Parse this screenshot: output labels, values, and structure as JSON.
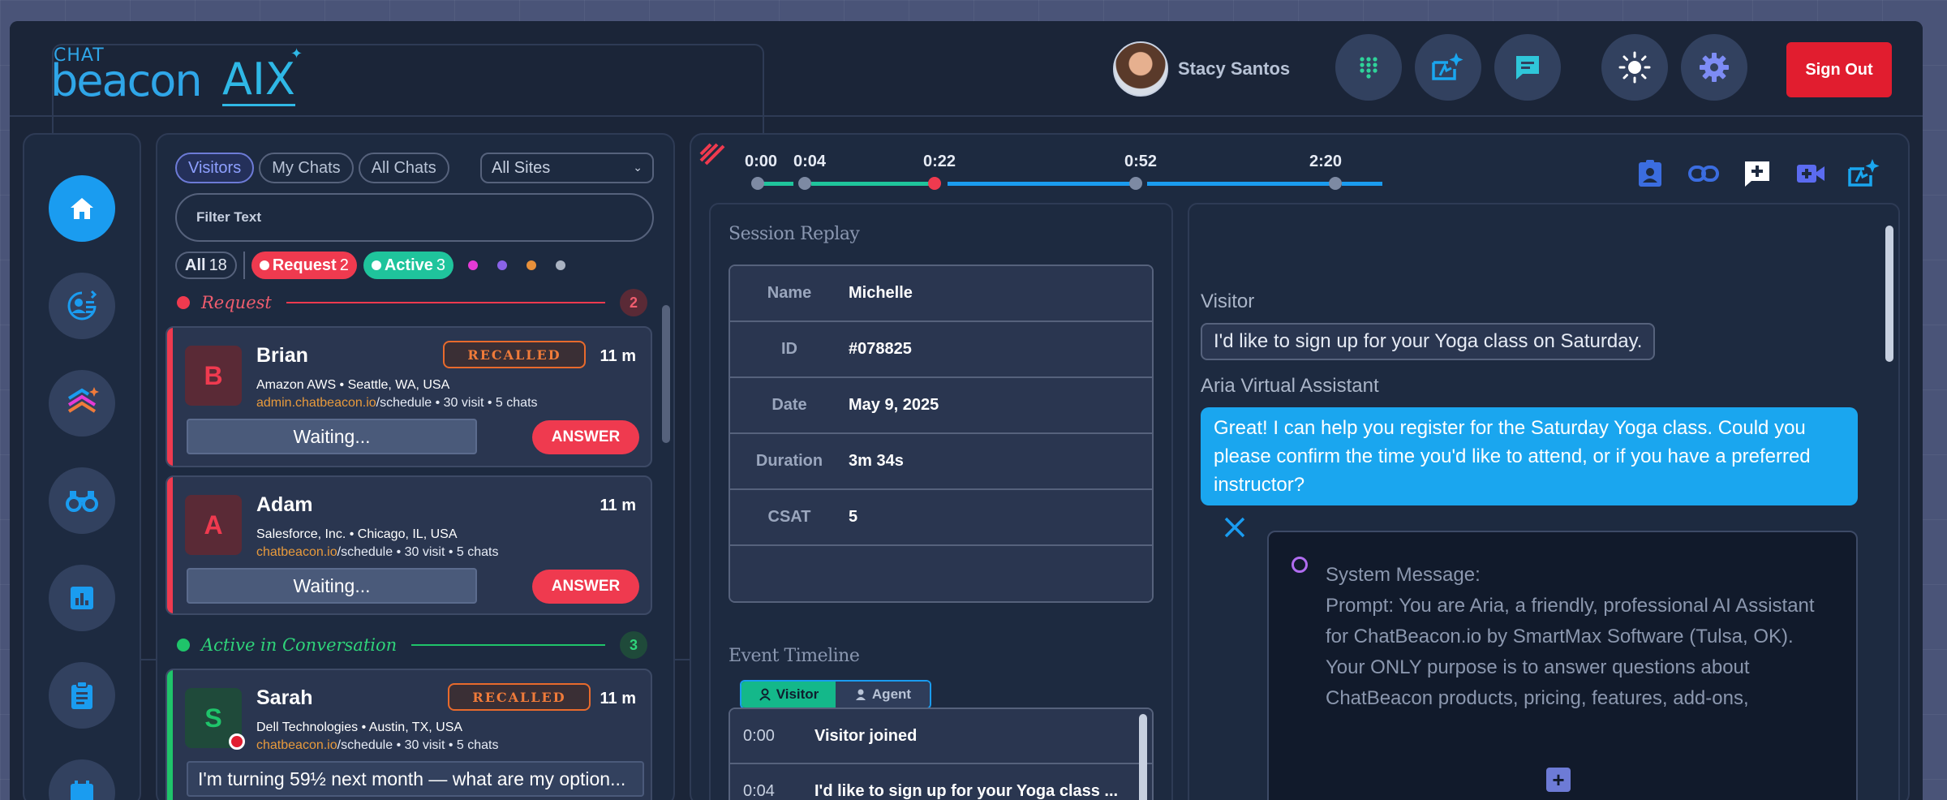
{
  "header": {
    "logo_chat": "CHAT",
    "logo_beacon": "beacon",
    "logo_aix": "AIX",
    "user_name": "Stacy Santos",
    "sign_out": "Sign Out"
  },
  "icons": {
    "header": [
      "grid-dots-icon",
      "ai-spark-icon",
      "chat-bubble-icon",
      "sun-icon",
      "gear-icon"
    ],
    "sidebar": [
      "home-icon",
      "agents-icon",
      "layers-icon",
      "binoculars-icon",
      "reports-icon",
      "clipboard-icon",
      "calendar-icon"
    ],
    "toolbar": [
      "contact-card-icon",
      "link-icon",
      "add-note-icon",
      "video-icon",
      "ai-spark-icon"
    ]
  },
  "list": {
    "tabs": [
      "Visitors",
      "My Chats",
      "All Chats"
    ],
    "site_select": "All Sites",
    "filter_placeholder": "Filter Text",
    "chips": {
      "all_label": "All",
      "all_count": "18",
      "request_label": "Request",
      "request_count": "2",
      "active_label": "Active",
      "active_count": "3"
    },
    "colors": [
      "#e63ad6",
      "#8a63e8",
      "#e8903a",
      "#aab3c2"
    ],
    "request_section": {
      "title": "Request",
      "count": "2"
    },
    "active_section": {
      "title": "Active in Conversation",
      "count": "3"
    },
    "cards": [
      {
        "initial": "B",
        "name": "Brian",
        "recalled": "RECALLED",
        "time": "11 m",
        "org": "Amazon AWS • Seattle, WA, USA",
        "domain": "admin.chatbeacon.io",
        "path": "/schedule • 30 visit • 5 chats",
        "status": "Waiting...",
        "action": "ANSWER"
      },
      {
        "initial": "A",
        "name": "Adam",
        "time": "11 m",
        "org": "Salesforce, Inc. • Chicago, IL, USA",
        "domain": "chatbeacon.io",
        "path": "/schedule • 30 visit • 5 chats",
        "status": "Waiting...",
        "action": "ANSWER"
      },
      {
        "initial": "S",
        "name": "Sarah",
        "recalled": "RECALLED",
        "time": "11 m",
        "org": "Dell Technologies • Austin, TX, USA",
        "domain": "chatbeacon.io",
        "path": "/schedule • 30 visit • 5 chats",
        "preview": "I'm turning 59½ next month — what are my option..."
      }
    ]
  },
  "timeline": {
    "marks": [
      "0:00",
      "0:04",
      "0:22",
      "0:52",
      "2:20"
    ]
  },
  "replay": {
    "title": "Session Replay",
    "rows": [
      {
        "label": "Name",
        "value": "Michelle"
      },
      {
        "label": "ID",
        "value": "#078825"
      },
      {
        "label": "Date",
        "value": "May 9, 2025"
      },
      {
        "label": "Duration",
        "value": "3m 34s"
      },
      {
        "label": "CSAT",
        "value": "5"
      }
    ],
    "event_title": "Event Timeline",
    "toggle_visitor": "Visitor",
    "toggle_agent": "Agent",
    "events": [
      {
        "time": "0:00",
        "text": "Visitor joined"
      },
      {
        "time": "0:04",
        "text": "I'd like to sign up for your Yoga class ..."
      }
    ]
  },
  "conversation": {
    "visitor_label": "Visitor",
    "visitor_msg": "I'd like to sign up for your Yoga class on Saturday.",
    "assistant_label": "Aria Virtual Assistant",
    "assistant_msg": "Great! I can help you register for the Saturday Yoga class. Could you please confirm the time you'd like to attend, or if you have a preferred instructor?",
    "system_title": "System Message:",
    "system_text": "Prompt: You are Aria, a friendly, professional AI Assistant for ChatBeacon.io by SmartMax Software (Tulsa, OK).",
    "system_text2": "Your ONLY purpose is to answer questions about ChatBeacon products, pricing, features, add-ons,"
  }
}
